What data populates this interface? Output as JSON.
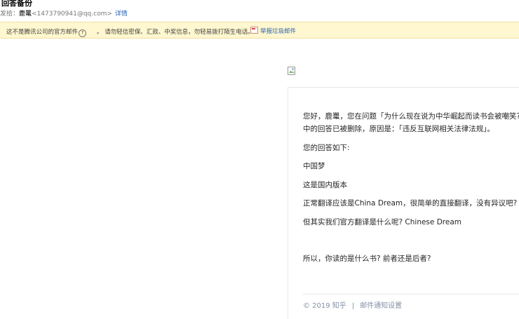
{
  "header": {
    "subject": "回答备份",
    "from_label": "发给：",
    "sender_name": "鹿鼍",
    "sender_email": "<1473790941@qq.com>",
    "detail_link": "详情"
  },
  "warning": {
    "text_before": "这不是腾讯公司的官方邮件",
    "help_icon": "?",
    "text_after": "。 请勿轻信密保、汇款、中奖信息，勿轻易拨打陌生电话。",
    "report_link": "举报垃圾邮件"
  },
  "email_body": {
    "line1": "您好，鹿鼍，您在问题「为什么现在说为中华崛起而读书会被嘲笑?」",
    "line2": "中的回答已被删除，原因是：「违反互联网相关法律法规」。",
    "line3": "您的回答如下:",
    "line4": "中国梦",
    "line5": "这是国内版本",
    "line6": "正常翻译应该是China Dream，很简单的直接翻译，没有异议吧?",
    "line7": "但其实我们官方翻译是什么呢? Chinese Dream",
    "line8": "所以，你读的是什么书? 前者还是后者?"
  },
  "footer": {
    "copyright": "© 2019 知乎",
    "separator": "|",
    "settings_link": "邮件通知设置"
  }
}
